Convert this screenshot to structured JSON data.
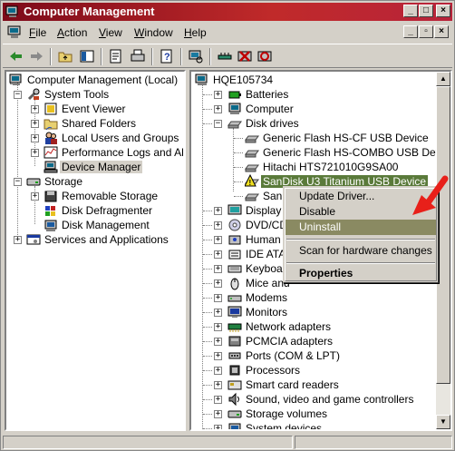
{
  "window": {
    "title": "Computer Management"
  },
  "menubar": {
    "items": [
      {
        "label": "File",
        "key": "F",
        "rest": "ile"
      },
      {
        "label": "Action",
        "key": "A",
        "rest": "ction"
      },
      {
        "label": "View",
        "key": "V",
        "rest": "iew"
      },
      {
        "label": "Window",
        "key": "W",
        "rest": "indow"
      },
      {
        "label": "Help",
        "key": "H",
        "rest": "elp"
      }
    ]
  },
  "left_tree": [
    {
      "label": "Computer Management (Local)"
    },
    {
      "label": "System Tools"
    },
    {
      "label": "Event Viewer"
    },
    {
      "label": "Shared Folders"
    },
    {
      "label": "Local Users and Groups"
    },
    {
      "label": "Performance Logs and Alerts"
    },
    {
      "label": "Device Manager"
    },
    {
      "label": "Storage"
    },
    {
      "label": "Removable Storage"
    },
    {
      "label": "Disk Defragmenter"
    },
    {
      "label": "Disk Management"
    },
    {
      "label": "Services and Applications"
    }
  ],
  "right_tree": [
    {
      "label": "HQE105734"
    },
    {
      "label": "Batteries"
    },
    {
      "label": "Computer"
    },
    {
      "label": "Disk drives"
    },
    {
      "label": "Generic Flash HS-CF USB Device"
    },
    {
      "label": "Generic Flash HS-COMBO USB Device"
    },
    {
      "label": "Hitachi HTS721010G9SA00"
    },
    {
      "label": "SanDisk U3 Titanium USB Device"
    },
    {
      "label": "San"
    },
    {
      "label": "Display a"
    },
    {
      "label": "DVD/CD"
    },
    {
      "label": "Human I"
    },
    {
      "label": "IDE ATA"
    },
    {
      "label": "Keyboar"
    },
    {
      "label": "Mice and"
    },
    {
      "label": "Modems"
    },
    {
      "label": "Monitors"
    },
    {
      "label": "Network adapters"
    },
    {
      "label": "PCMCIA adapters"
    },
    {
      "label": "Ports (COM & LPT)"
    },
    {
      "label": "Processors"
    },
    {
      "label": "Smart card readers"
    },
    {
      "label": "Sound, video and game controllers"
    },
    {
      "label": "Storage volumes"
    },
    {
      "label": "System devices"
    }
  ],
  "context_menu": {
    "items": [
      {
        "label": "Update Driver..."
      },
      {
        "label": "Disable"
      },
      {
        "label": "Uninstall"
      },
      {
        "label": "Scan for hardware changes"
      },
      {
        "label": "Properties"
      }
    ]
  },
  "colors": {
    "title_bar": "#7d0a1a",
    "selection": "#5a7a3a",
    "menu_highlight": "#8a8a62",
    "arrow": "#e8201a"
  }
}
